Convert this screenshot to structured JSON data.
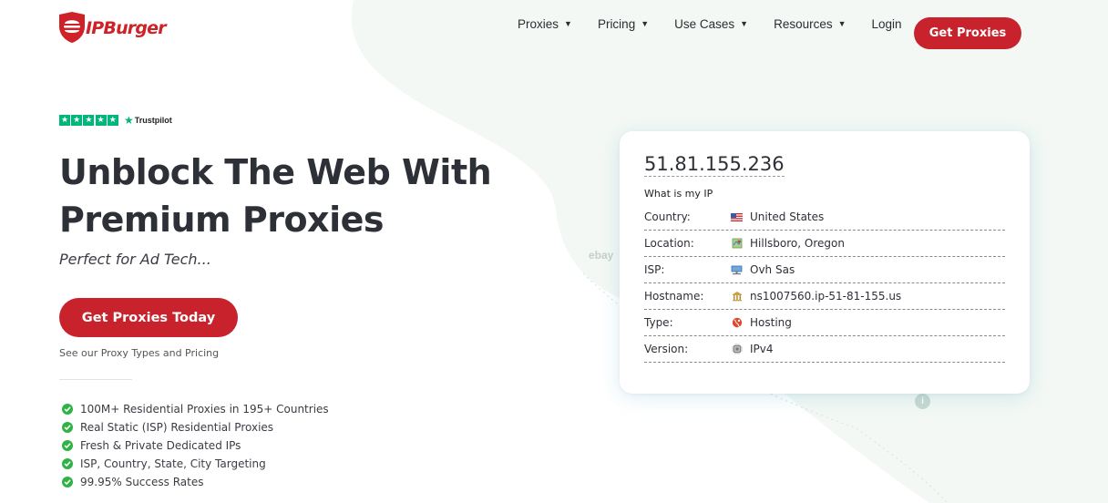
{
  "brand": {
    "name": "IPBurger",
    "accent": "#c8232c"
  },
  "nav": {
    "items": [
      {
        "label": "Proxies",
        "chevron": true
      },
      {
        "label": "Pricing",
        "chevron": true
      },
      {
        "label": "Use Cases",
        "chevron": true
      },
      {
        "label": "Resources",
        "chevron": true
      },
      {
        "label": "Login",
        "chevron": false
      }
    ],
    "cta_label": "Get Proxies"
  },
  "trustpilot": {
    "label": "Trustpilot",
    "stars": 5
  },
  "hero": {
    "title_line1": "Unblock The Web With",
    "title_line2": "Premium Proxies",
    "subtitle": "Perfect for Ad Tech...",
    "cta_label": "Get Proxies Today",
    "link_text": "See our Proxy Types and Pricing",
    "features": [
      "100M+ Residential Proxies in 195+ Countries",
      "Real Static (ISP) Residential Proxies",
      "Fresh & Private Dedicated IPs",
      "ISP, Country, State, City Targeting",
      "99.95% Success Rates"
    ]
  },
  "ip_card": {
    "ip": "51.81.155.236",
    "caption": "What is my IP",
    "rows": [
      {
        "label": "Country:",
        "value": "United States",
        "icon": "us-flag-icon"
      },
      {
        "label": "Location:",
        "value": "Hillsboro, Oregon",
        "icon": "map-icon"
      },
      {
        "label": "ISP:",
        "value": "Ovh Sas",
        "icon": "network-icon"
      },
      {
        "label": "Hostname:",
        "value": "ns1007560.ip-51-81-155.us",
        "icon": "server-icon"
      },
      {
        "label": "Type:",
        "value": "Hosting",
        "icon": "globe-icon"
      },
      {
        "label": "Version:",
        "value": "IPv4",
        "icon": "chip-icon"
      }
    ]
  },
  "background": {
    "partner_logo": "ebay"
  }
}
